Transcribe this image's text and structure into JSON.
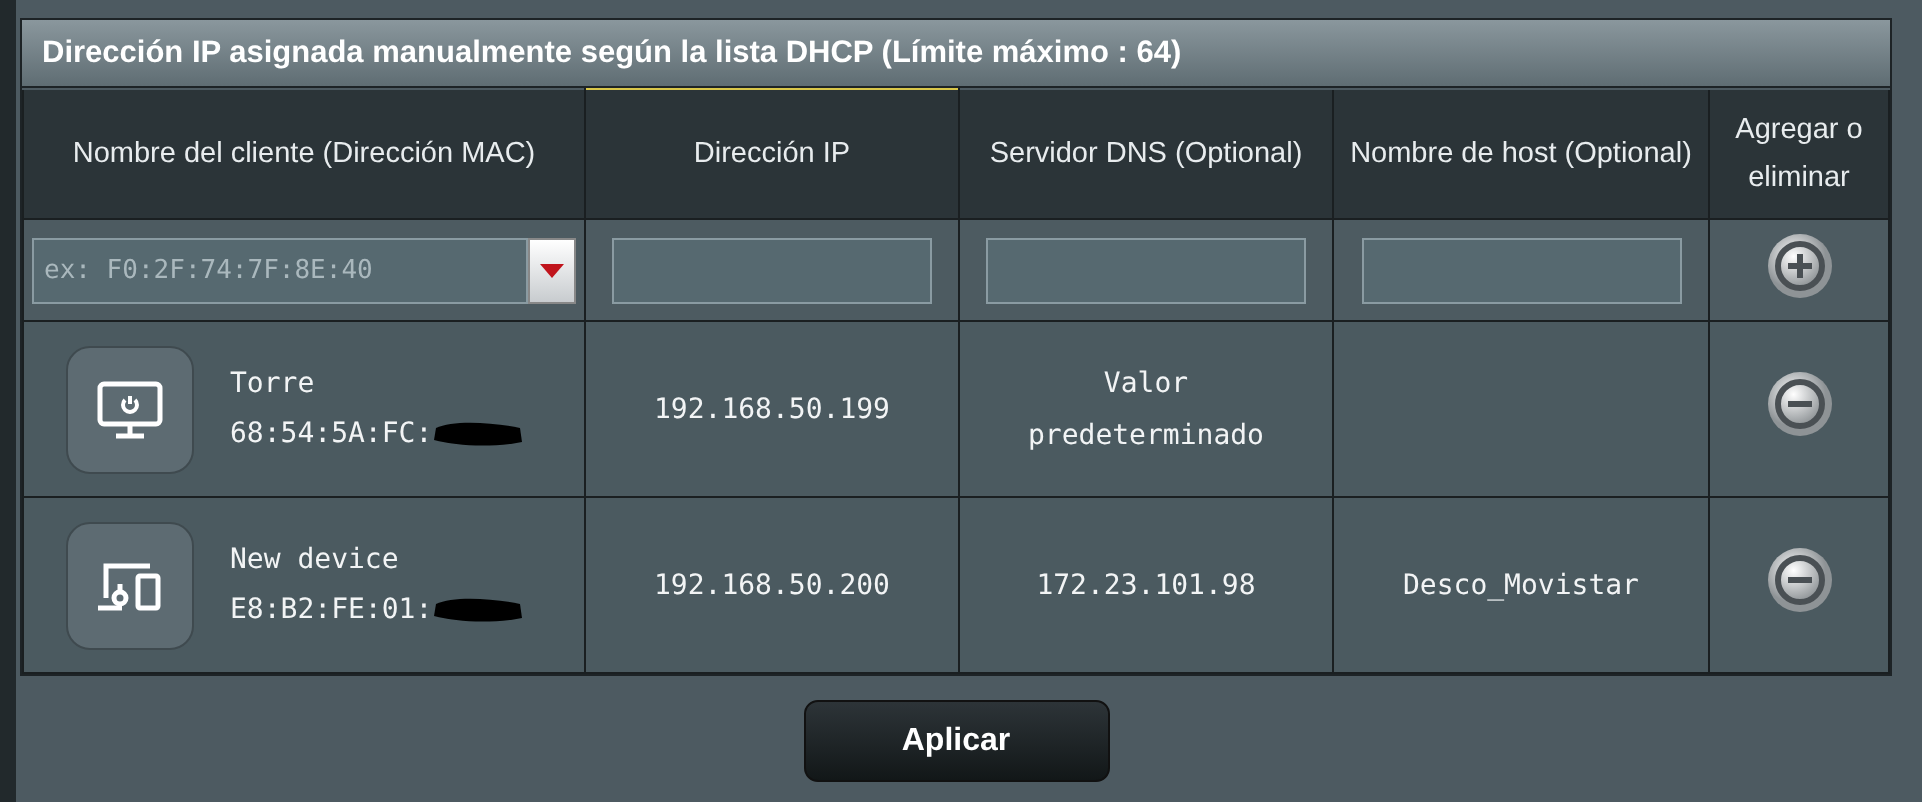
{
  "panel": {
    "title": "Dirección IP asignada manualmente según la lista DHCP (Límite máximo : 64)"
  },
  "columns": [
    "Nombre del cliente (Dirección MAC)",
    "Dirección IP",
    "Servidor DNS (Optional)",
    "Nombre de host (Optional)",
    "Agregar o eliminar"
  ],
  "new_entry": {
    "client_placeholder": "ex: F0:2F:74:7F:8E:40"
  },
  "rows": [
    {
      "kind": "desktop",
      "name": "Torre",
      "mac": "68:54:5A:FC:",
      "redacted": true,
      "ip": "192.168.50.199",
      "dns": "Valor predeterminado"
    },
    {
      "kind": "devices",
      "name": "New device",
      "mac": "E8:B2:FE:01:",
      "redacted": true,
      "ip": "192.168.50.200",
      "dns": "172.23.101.98",
      "host": "Desco_Movistar"
    }
  ],
  "apply_button": "Aplicar"
}
